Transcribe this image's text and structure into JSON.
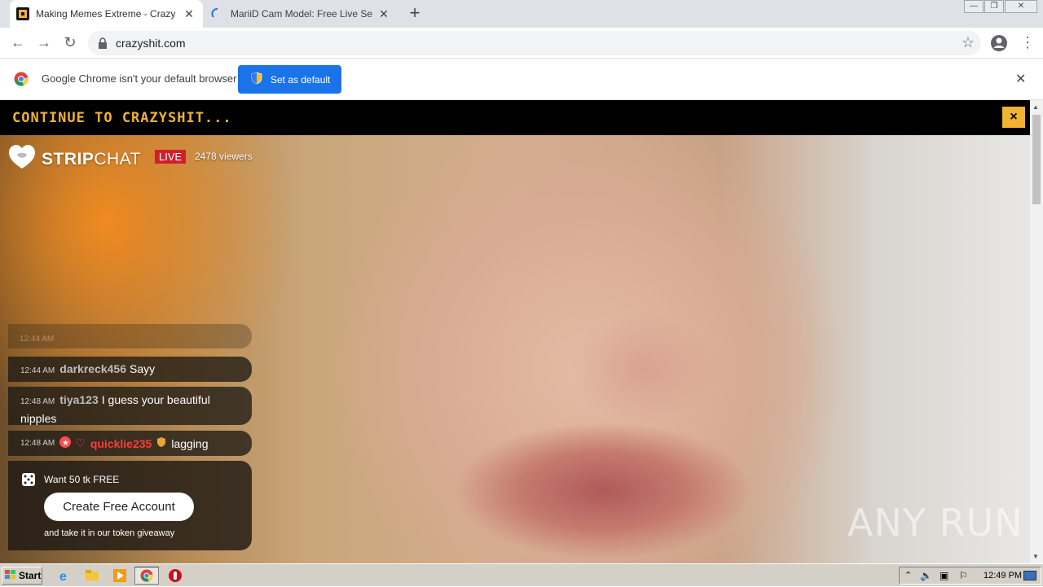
{
  "browser": {
    "tabs": [
      {
        "title": "Making Memes Extreme - Crazy Shit",
        "favicon": "crazyshit-favicon",
        "active": true
      },
      {
        "title": "MariiD Cam Model: Free Live Sex Sho",
        "favicon": "loading-spinner-icon",
        "active": false
      }
    ],
    "url": "crazyshit.com",
    "infobar": {
      "message": "Google Chrome isn't your default browser",
      "button_label": "Set as default"
    }
  },
  "page": {
    "continue_label": "CONTINUE TO CRAZYSHIT...",
    "close_label": "×",
    "logo": {
      "strip": "STRIP",
      "chat": "CHAT"
    },
    "live_label": "LIVE",
    "viewers": "2478 viewers",
    "chat": [
      {
        "time": "12:44 AM",
        "user": "darkreck456",
        "text": "Sayy"
      },
      {
        "time": "12:48 AM",
        "user": "tiya123",
        "text": "I guess your beautiful nipples"
      },
      {
        "time": "12:48 AM",
        "user": "quicklie235",
        "text": "lagging"
      }
    ],
    "faded_time": "12:44 AM",
    "promo": {
      "want": "Want 50 tk FREE",
      "button": "Create Free Account",
      "take": "and take it in our token giveaway"
    },
    "watermark": "ANY RUN"
  },
  "taskbar": {
    "start_label": "Start",
    "clock": "12:49 PM"
  },
  "colors": {
    "accent_yellow": "#f2b233",
    "chrome_blue": "#1a73e8",
    "live_red": "#d21f2d"
  }
}
